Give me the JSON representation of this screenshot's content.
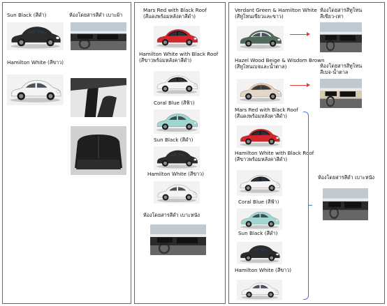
{
  "panel1": {
    "items": [
      {
        "label": "Sun Black (สีดำ)",
        "color": "#2b2b2b",
        "roof": "#2b2b2b"
      },
      {
        "label": "Hamilton White (สีขาว)",
        "color": "#f4f4f4",
        "roof": "#f4f4f4"
      }
    ],
    "interior_label": "ห้องโดยสารสีดำ เบาะผ้า"
  },
  "panel2": {
    "items": [
      {
        "label": "Mars Red with Black Roof\n(สีแดงพร้อมหลังคาสีดำ)",
        "color": "#d3272c",
        "roof": "#1a1a1a"
      },
      {
        "label": "Hamilton White with Black Roof\n(สีขาวพร้อมหลังคาสีดำ)",
        "color": "#f4f4f4",
        "roof": "#1a1a1a"
      },
      {
        "label": "Coral Blue (สีฟ้า)",
        "color": "#9fd6d1",
        "roof": "#9fd6d1"
      },
      {
        "label": "Sun Black (สีดำ)",
        "color": "#2b2b2b",
        "roof": "#2b2b2b"
      },
      {
        "label": "Hamilton White (สีขาว)",
        "color": "#f4f4f4",
        "roof": "#f4f4f4"
      }
    ],
    "interior_label": "ห้องโดยสารสีดำ เบาะหนัง"
  },
  "panel3": {
    "top_items": [
      {
        "label": "Verdant Green & Hamilton White\n(สีทูโทนเขียวและขาว)",
        "color": "#4f6a58",
        "roof": "#f4f4f4",
        "interior_label": "ห้องโดยสารสีทูโทน\nสีเขียว-เทา"
      },
      {
        "label": "Hazel Wood Beige & Wisdom Brown\n(สีทูโทนเบจและน้ำตาล)",
        "color": "#e3d6c6",
        "roof": "#6b4c3b",
        "interior_label": "ห้องโดยสารสีทูโทน\nสีเบจ-น้ำตาล"
      }
    ],
    "items": [
      {
        "label": "Mars Red with Black Roof\n(สีแดงพร้อมหลังคาสีดำ)",
        "color": "#d3272c",
        "roof": "#1a1a1a"
      },
      {
        "label": "Hamilton White with Black Roof\n(สีขาวพร้อมหลังคาสีดำ)",
        "color": "#f4f4f4",
        "roof": "#1a1a1a"
      },
      {
        "label": "Coral Blue (สีฟ้า)",
        "color": "#9fd6d1",
        "roof": "#9fd6d1"
      },
      {
        "label": "Sun Black (สีดำ)",
        "color": "#2b2b2b",
        "roof": "#2b2b2b"
      },
      {
        "label": "Hamilton White (สีขาว)",
        "color": "#f4f4f4",
        "roof": "#f4f4f4"
      }
    ],
    "interior_label": "ห้องโดยสารสีดำ เบาะหนัง"
  },
  "colors": {
    "arrow": "#e23b3b",
    "brace": "#4a78c7",
    "border": "#666666"
  }
}
